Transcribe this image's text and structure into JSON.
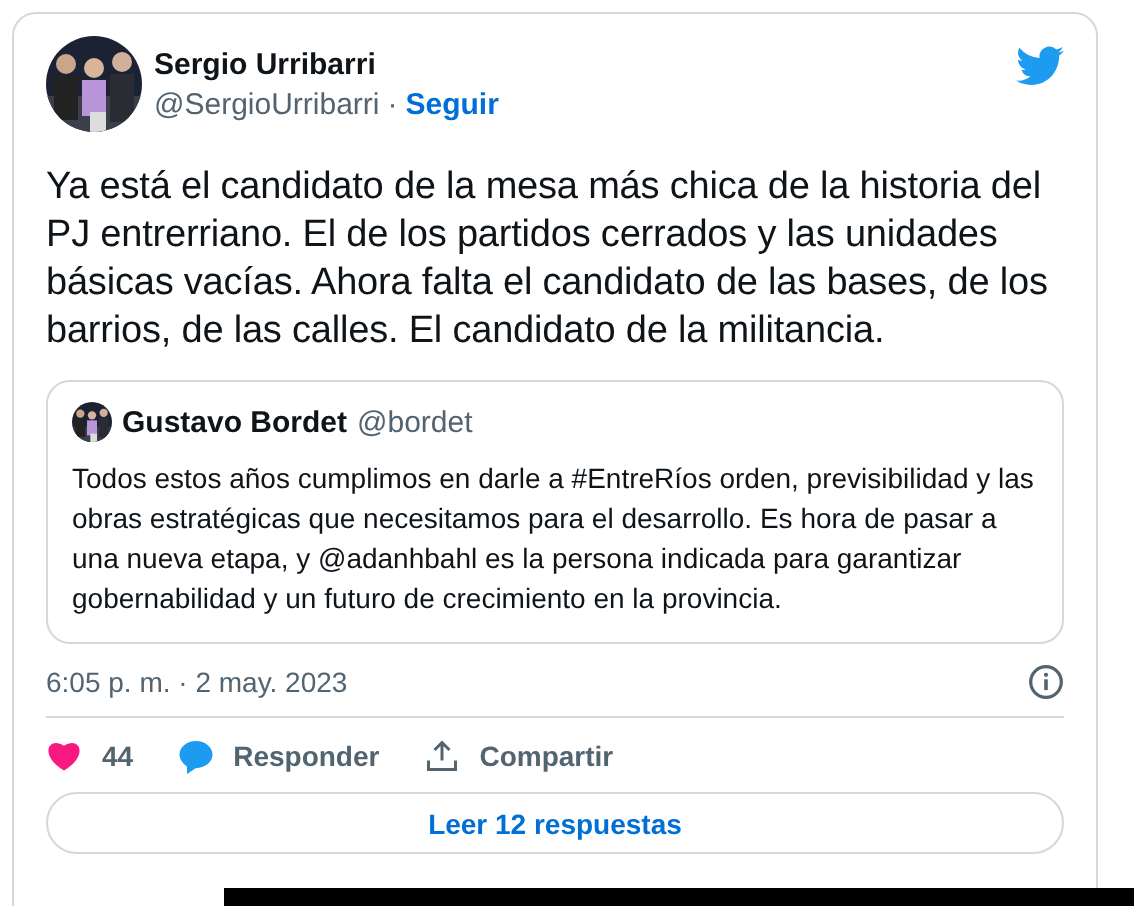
{
  "author": {
    "name": "Sergio Urribarri",
    "handle": "@SergioUrribarri",
    "separator": "·",
    "follow": "Seguir"
  },
  "text": "Ya está el candidato de la mesa más chica de la historia del PJ entrerriano. El de los partidos cerrados y las unidades básicas vacías. Ahora falta el candidato de las bases, de los barrios, de las calles. El candidato de la militancia.",
  "quoted": {
    "name": "Gustavo Bordet",
    "handle": "@bordet",
    "text": "Todos estos años cumplimos en darle a #EntreRíos orden, previsibilidad y las obras estratégicas que necesitamos para el desarrollo. Es hora de pasar a una nueva etapa, y @adanhbahl es la persona indicada para garantizar gobernabilidad y un futuro de crecimiento en la provincia."
  },
  "timestamp": "6:05 p. m. · 2 may. 2023",
  "actions": [
    {
      "kind": "like",
      "label": "44"
    },
    {
      "kind": "reply",
      "label": "Responder"
    },
    {
      "kind": "share",
      "label": "Compartir"
    }
  ],
  "read_replies": "Leer 12 respuestas"
}
